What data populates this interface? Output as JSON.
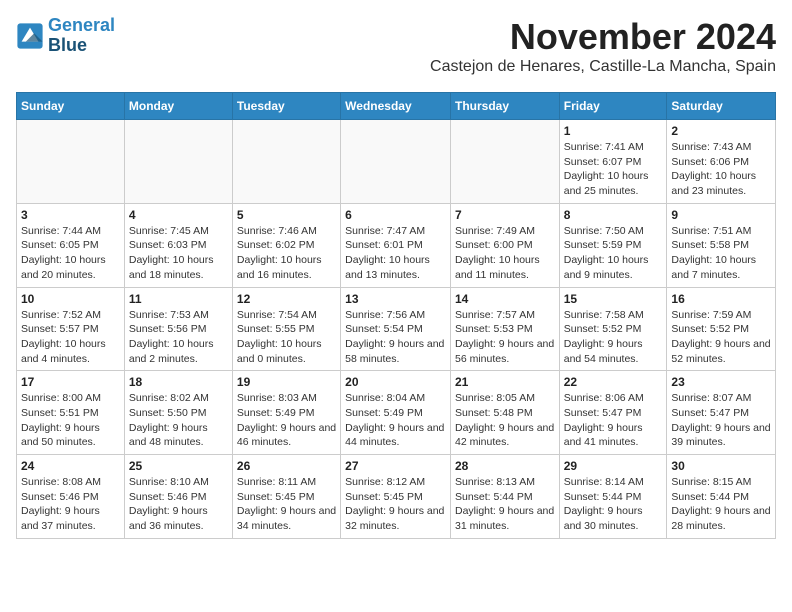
{
  "logo": {
    "line1": "General",
    "line2": "Blue"
  },
  "title": "November 2024",
  "location": "Castejon de Henares, Castille-La Mancha, Spain",
  "days_of_week": [
    "Sunday",
    "Monday",
    "Tuesday",
    "Wednesday",
    "Thursday",
    "Friday",
    "Saturday"
  ],
  "weeks": [
    [
      {
        "day": "",
        "info": ""
      },
      {
        "day": "",
        "info": ""
      },
      {
        "day": "",
        "info": ""
      },
      {
        "day": "",
        "info": ""
      },
      {
        "day": "",
        "info": ""
      },
      {
        "day": "1",
        "info": "Sunrise: 7:41 AM\nSunset: 6:07 PM\nDaylight: 10 hours and 25 minutes."
      },
      {
        "day": "2",
        "info": "Sunrise: 7:43 AM\nSunset: 6:06 PM\nDaylight: 10 hours and 23 minutes."
      }
    ],
    [
      {
        "day": "3",
        "info": "Sunrise: 7:44 AM\nSunset: 6:05 PM\nDaylight: 10 hours and 20 minutes."
      },
      {
        "day": "4",
        "info": "Sunrise: 7:45 AM\nSunset: 6:03 PM\nDaylight: 10 hours and 18 minutes."
      },
      {
        "day": "5",
        "info": "Sunrise: 7:46 AM\nSunset: 6:02 PM\nDaylight: 10 hours and 16 minutes."
      },
      {
        "day": "6",
        "info": "Sunrise: 7:47 AM\nSunset: 6:01 PM\nDaylight: 10 hours and 13 minutes."
      },
      {
        "day": "7",
        "info": "Sunrise: 7:49 AM\nSunset: 6:00 PM\nDaylight: 10 hours and 11 minutes."
      },
      {
        "day": "8",
        "info": "Sunrise: 7:50 AM\nSunset: 5:59 PM\nDaylight: 10 hours and 9 minutes."
      },
      {
        "day": "9",
        "info": "Sunrise: 7:51 AM\nSunset: 5:58 PM\nDaylight: 10 hours and 7 minutes."
      }
    ],
    [
      {
        "day": "10",
        "info": "Sunrise: 7:52 AM\nSunset: 5:57 PM\nDaylight: 10 hours and 4 minutes."
      },
      {
        "day": "11",
        "info": "Sunrise: 7:53 AM\nSunset: 5:56 PM\nDaylight: 10 hours and 2 minutes."
      },
      {
        "day": "12",
        "info": "Sunrise: 7:54 AM\nSunset: 5:55 PM\nDaylight: 10 hours and 0 minutes."
      },
      {
        "day": "13",
        "info": "Sunrise: 7:56 AM\nSunset: 5:54 PM\nDaylight: 9 hours and 58 minutes."
      },
      {
        "day": "14",
        "info": "Sunrise: 7:57 AM\nSunset: 5:53 PM\nDaylight: 9 hours and 56 minutes."
      },
      {
        "day": "15",
        "info": "Sunrise: 7:58 AM\nSunset: 5:52 PM\nDaylight: 9 hours and 54 minutes."
      },
      {
        "day": "16",
        "info": "Sunrise: 7:59 AM\nSunset: 5:52 PM\nDaylight: 9 hours and 52 minutes."
      }
    ],
    [
      {
        "day": "17",
        "info": "Sunrise: 8:00 AM\nSunset: 5:51 PM\nDaylight: 9 hours and 50 minutes."
      },
      {
        "day": "18",
        "info": "Sunrise: 8:02 AM\nSunset: 5:50 PM\nDaylight: 9 hours and 48 minutes."
      },
      {
        "day": "19",
        "info": "Sunrise: 8:03 AM\nSunset: 5:49 PM\nDaylight: 9 hours and 46 minutes."
      },
      {
        "day": "20",
        "info": "Sunrise: 8:04 AM\nSunset: 5:49 PM\nDaylight: 9 hours and 44 minutes."
      },
      {
        "day": "21",
        "info": "Sunrise: 8:05 AM\nSunset: 5:48 PM\nDaylight: 9 hours and 42 minutes."
      },
      {
        "day": "22",
        "info": "Sunrise: 8:06 AM\nSunset: 5:47 PM\nDaylight: 9 hours and 41 minutes."
      },
      {
        "day": "23",
        "info": "Sunrise: 8:07 AM\nSunset: 5:47 PM\nDaylight: 9 hours and 39 minutes."
      }
    ],
    [
      {
        "day": "24",
        "info": "Sunrise: 8:08 AM\nSunset: 5:46 PM\nDaylight: 9 hours and 37 minutes."
      },
      {
        "day": "25",
        "info": "Sunrise: 8:10 AM\nSunset: 5:46 PM\nDaylight: 9 hours and 36 minutes."
      },
      {
        "day": "26",
        "info": "Sunrise: 8:11 AM\nSunset: 5:45 PM\nDaylight: 9 hours and 34 minutes."
      },
      {
        "day": "27",
        "info": "Sunrise: 8:12 AM\nSunset: 5:45 PM\nDaylight: 9 hours and 32 minutes."
      },
      {
        "day": "28",
        "info": "Sunrise: 8:13 AM\nSunset: 5:44 PM\nDaylight: 9 hours and 31 minutes."
      },
      {
        "day": "29",
        "info": "Sunrise: 8:14 AM\nSunset: 5:44 PM\nDaylight: 9 hours and 30 minutes."
      },
      {
        "day": "30",
        "info": "Sunrise: 8:15 AM\nSunset: 5:44 PM\nDaylight: 9 hours and 28 minutes."
      }
    ]
  ]
}
